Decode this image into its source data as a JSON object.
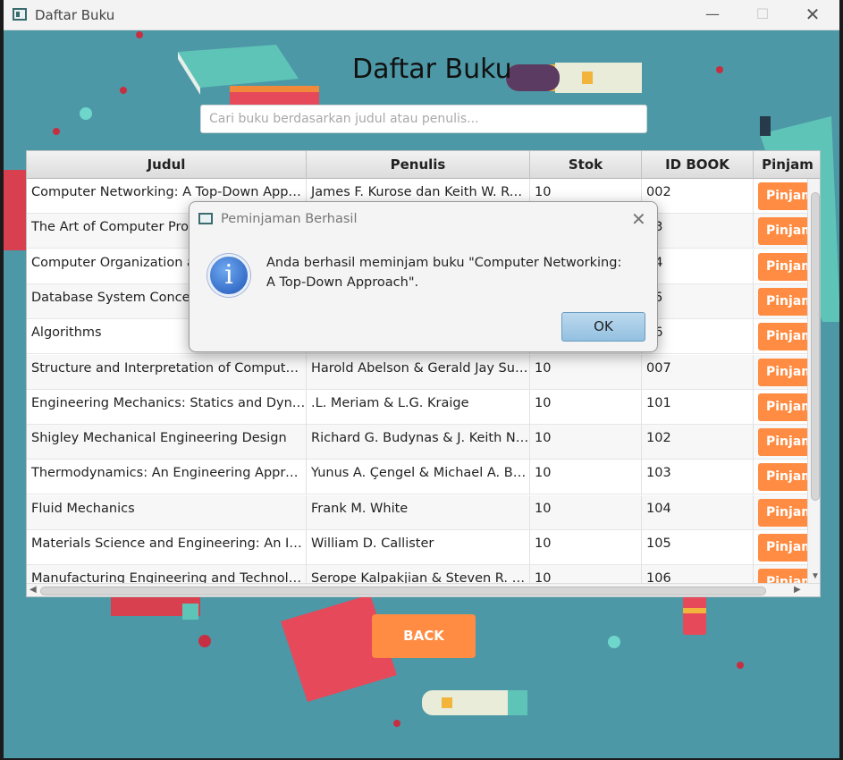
{
  "window": {
    "title": "Daftar Buku",
    "controls": {
      "minimize": "—",
      "maximize": "☐",
      "close": "✕"
    }
  },
  "header": {
    "title": "Daftar Buku"
  },
  "search": {
    "placeholder": "Cari buku berdasarkan judul atau penulis..."
  },
  "table": {
    "columns": [
      "Judul",
      "Penulis",
      "Stok",
      "ID BOOK",
      "Pinjam"
    ],
    "action_label": "Pinjam",
    "rows": [
      {
        "judul": "Computer Networking: A Top-Down Approa...",
        "penulis": "James F. Kurose dan Keith W. Ross",
        "stok": "10",
        "id": "002"
      },
      {
        "judul": "The Art of Computer Progr",
        "penulis": "",
        "stok": "",
        "id": "03"
      },
      {
        "judul": "Computer Organization and",
        "penulis": "",
        "stok": "",
        "id": "04"
      },
      {
        "judul": "Database System Concepts",
        "penulis": "",
        "stok": "",
        "id": "05"
      },
      {
        "judul": "Algorithms",
        "penulis": "",
        "stok": "",
        "id": "06"
      },
      {
        "judul": "Structure and Interpretation of Computer Pr...",
        "penulis": " Harold Abelson & Gerald Jay Suss...",
        "stok": "10",
        "id": "007"
      },
      {
        "judul": "Engineering Mechanics: Statics and Dynamics",
        "penulis": ".L. Meriam & L.G. Kraige",
        "stok": "10",
        "id": "101"
      },
      {
        "judul": "Shigley Mechanical Engineering Design",
        "penulis": "Richard G. Budynas & J. Keith Nisb...",
        "stok": "10",
        "id": "102"
      },
      {
        "judul": "Thermodynamics: An Engineering Approach",
        "penulis": "Yunus A. Çengel & Michael A. Boles",
        "stok": "10",
        "id": "103"
      },
      {
        "judul": "Fluid Mechanics",
        "penulis": "Frank M. White",
        "stok": "10",
        "id": "104"
      },
      {
        "judul": "Materials Science and Engineering: An Intro...",
        "penulis": "William D. Callister",
        "stok": "10",
        "id": "105"
      },
      {
        "judul": "Manufacturing Engineering and Technology",
        "penulis": "Serope Kalpakjian & Steven R. Sch...",
        "stok": "10",
        "id": "106"
      }
    ]
  },
  "back_button": {
    "label": "BACK"
  },
  "dialog": {
    "title": "Peminjaman Berhasil",
    "icon": "info-icon",
    "message": "Anda berhasil meminjam buku \"Computer Networking: A Top-Down Approach\".",
    "ok_label": "OK",
    "close": "✕"
  },
  "colors": {
    "background": "#4d98a6",
    "accent": "#ff8c42",
    "ok_button": "#a9cde8"
  }
}
